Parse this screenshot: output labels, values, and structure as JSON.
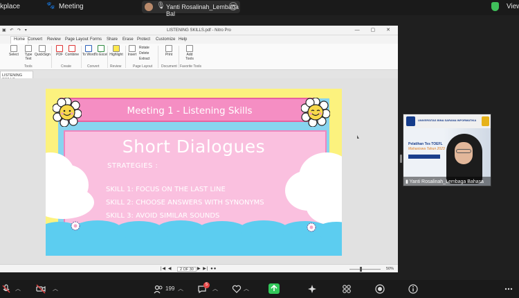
{
  "topbar": {
    "left_label": "kplace",
    "meeting_label": "Meeting",
    "speaker_name": "Yanti Rosalinah_Lembaga Bal",
    "view_label": "View"
  },
  "app": {
    "window_title": "LISTENING SKILLS.pdf - Nitro Pro",
    "menu_tabs": [
      "Home",
      "Convert",
      "Review",
      "Page Layout",
      "Forms",
      "Share",
      "Erase",
      "Protect",
      "Customize",
      "Help"
    ],
    "ribbon_buttons": {
      "select": "Select",
      "type_text": "Type Text",
      "quicksign": "QuickSign",
      "pdf": "PDF",
      "combine": "Combine",
      "to_word": "To Word",
      "to_excel": "To Excel",
      "highlight": "Highlight",
      "insert": "Insert",
      "rotate": "Rotate",
      "delete": "Delete",
      "extract": "Extract",
      "print": "Print",
      "add_tools": "Add Tools"
    },
    "ribbon_groups": [
      "Tools",
      "Create",
      "Convert",
      "Review",
      "Page Layout",
      "Document",
      "Favorite Tools"
    ],
    "doc_tab": "LISTENING SKILLS",
    "page_indicator": "2 OF 30",
    "zoom": "50%"
  },
  "slide": {
    "header": "Meeting 1 - Listening Skills",
    "title": "Short Dialogues",
    "strategies_label": "STRATEGIES :",
    "skills": [
      "SKILL 1: FOCUS ON THE LAST LINE",
      "SKILL 2: CHOOSE ANSWERS WITH SYNONYMS",
      "SKILL 3: AVOID SIMILAR SOUNDS"
    ]
  },
  "video": {
    "university": "UNIVERSITAS BINA SARANA INFORMATIKA",
    "line1": "Pelatihan Tes TOEFL",
    "line2": "Mahasiswa Tahun 2023",
    "participant_name": "Yanti Rosalinah_Lembaga Bahasa"
  },
  "toolbar": {
    "participants_count": "199",
    "chat_badge": "5"
  },
  "colors": {
    "slide_yellow": "#fcf27e",
    "slide_pink": "#f58ec3",
    "slide_sky": "#87d4ef",
    "share_green": "#32c85a"
  }
}
